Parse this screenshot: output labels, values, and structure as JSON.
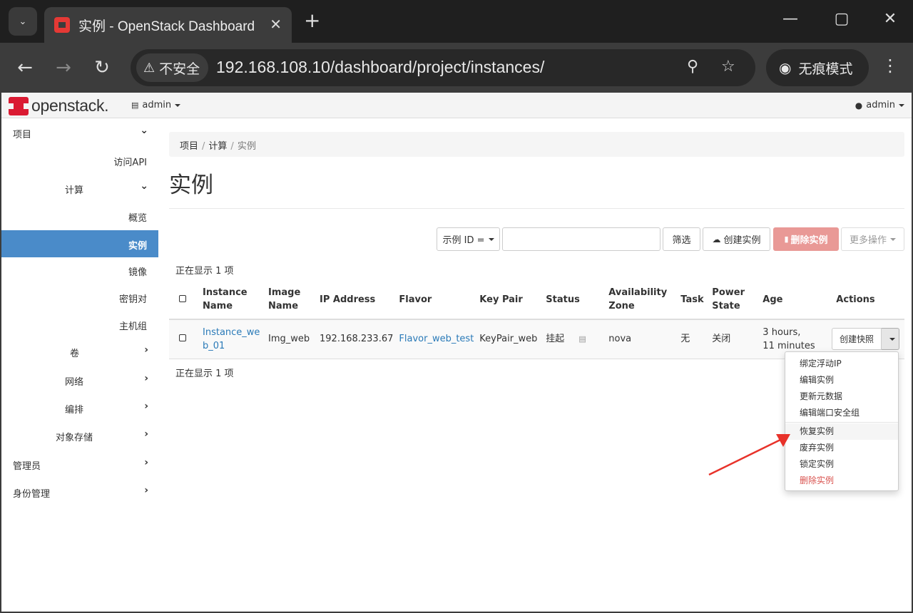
{
  "browser": {
    "tab_title": "实例 - OpenStack Dashboard",
    "security_label": "不安全",
    "url": "192.168.108.10/dashboard/project/instances/",
    "incognito_label": "无痕模式"
  },
  "header": {
    "logo_text": "openstack.",
    "project": "admin",
    "user": "admin"
  },
  "sidebar": {
    "items": [
      {
        "label": "项目"
      },
      {
        "label": "访问API"
      },
      {
        "label": "计算"
      },
      {
        "label": "概览"
      },
      {
        "label": "实例"
      },
      {
        "label": "镜像"
      },
      {
        "label": "密钥对"
      },
      {
        "label": "主机组"
      },
      {
        "label": "卷"
      },
      {
        "label": "网络"
      },
      {
        "label": "编排"
      },
      {
        "label": "对象存储"
      },
      {
        "label": "管理员"
      },
      {
        "label": "身份管理"
      }
    ]
  },
  "breadcrumb": {
    "items": [
      "项目",
      "计算",
      "实例"
    ],
    "separator": "/"
  },
  "page": {
    "title": "实例",
    "showing_top": "正在显示 1 项",
    "showing_bottom": "正在显示 1 项"
  },
  "toolbar": {
    "filter_field": "示例 ID =",
    "filter_value": "",
    "filter_button": "筛选",
    "create_button": "创建实例",
    "delete_button": "删除实例",
    "more_button": "更多操作"
  },
  "table": {
    "headers": {
      "instance_name": [
        "Instance",
        "Name"
      ],
      "image_name": [
        "Image",
        "Name"
      ],
      "ip_address": "IP Address",
      "flavor": "Flavor",
      "key_pair": "Key Pair",
      "status": "Status",
      "availability_zone": [
        "Availability",
        "Zone"
      ],
      "task": "Task",
      "power_state": [
        "Power",
        "State"
      ],
      "age": "Age",
      "actions": "Actions"
    },
    "rows": [
      {
        "instance_name": [
          "Instance_we",
          "b_01"
        ],
        "image_name": "Img_web",
        "ip_address": "192.168.233.67",
        "flavor": "Flavor_web_test",
        "key_pair": "KeyPair_web",
        "status": "挂起",
        "availability_zone": "nova",
        "task": "无",
        "power_state": "关闭",
        "age": [
          "3 hours,",
          "11 minutes"
        ],
        "action_button": "创建快照"
      }
    ]
  },
  "dropdown": {
    "items": [
      "绑定浮动IP",
      "编辑实例",
      "更新元数据",
      "编辑端口安全组",
      "恢复实例",
      "废弃实例",
      "锁定实例",
      "删除实例"
    ]
  },
  "colors": {
    "accent": "#4a8bc9",
    "link": "#2a7ab8",
    "danger": "#d9534f",
    "danger_button": "#e99996",
    "annotation_arrow": "#e8322a"
  }
}
